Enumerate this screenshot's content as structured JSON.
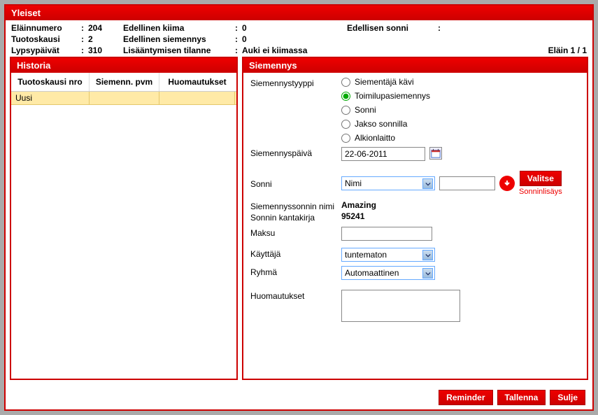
{
  "header": {
    "title": "Yleiset"
  },
  "info": {
    "animal_no_label": "Eläinnumero",
    "animal_no": "204",
    "lactation_label": "Tuotoskausi",
    "lactation": "2",
    "days_label": "Lypsypäivät",
    "days": "310",
    "prev_heat_label": "Edellinen kiima",
    "prev_heat": "0",
    "prev_insem_label": "Edellinen siemennys",
    "prev_insem": "0",
    "repro_status_label": "Lisääntymisen tilanne",
    "repro_status": "Auki ei kiimassa",
    "prev_bull_label": "Edellisen sonni",
    "prev_bull": "",
    "counter": "Eläin 1 / 1"
  },
  "history": {
    "title": "Historia",
    "columns": [
      "Tuotoskausi nro",
      "Siemenn. pvm",
      "Huomautukset"
    ],
    "rows": [
      {
        "c1": "Uusi",
        "c2": "",
        "c3": ""
      }
    ]
  },
  "form": {
    "title": "Siemennys",
    "type_label": "Siemennystyyppi",
    "radios": {
      "r1": "Siementäjä kävi",
      "r2": "Toimilupasiemennys",
      "r3": "Sonni",
      "r4": "Jakso sonnilla",
      "r5": "Alkionlaitto"
    },
    "date_label": "Siemennyspäivä",
    "date_value": "22-06-2011",
    "bull_label": "Sonni",
    "bull_select": "Nimi",
    "bull_input": "",
    "select_btn": "Valitse",
    "add_bull_link": "Sonninlisäys",
    "bull_name_label": "Siemennyssonnin nimi",
    "bull_name": "Amazing",
    "herdbook_label": "Sonnin kantakirja",
    "herdbook": "95241",
    "fee_label": "Maksu",
    "fee": "",
    "user_label": "Käyttäjä",
    "user": "tuntematon",
    "group_label": "Ryhmä",
    "group": "Automaattinen",
    "remarks_label": "Huomautukset",
    "remarks": ""
  },
  "footer": {
    "reminder": "Reminder",
    "save": "Tallenna",
    "close": "Sulje"
  }
}
